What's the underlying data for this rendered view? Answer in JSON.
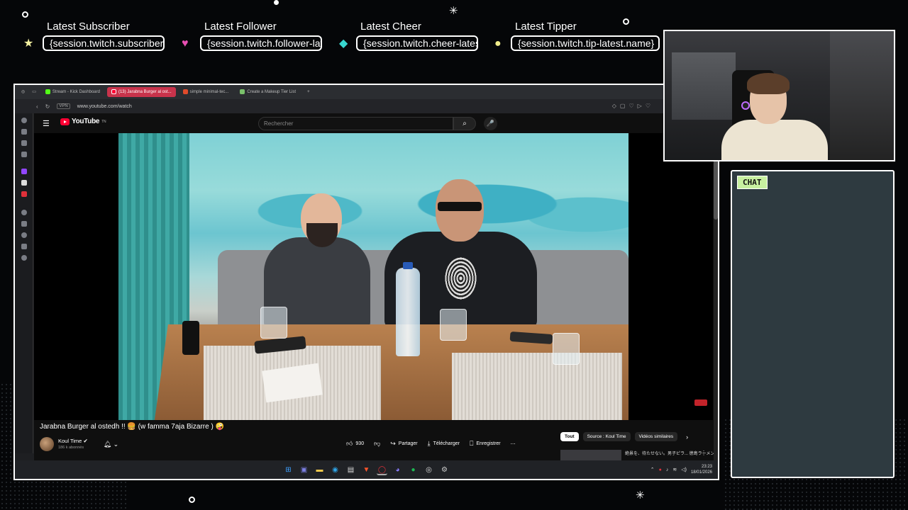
{
  "overlay": {
    "alerts": [
      {
        "label": "Latest Subscriber",
        "value": "{session.twitch.subscriber-latest.name}"
      },
      {
        "label": "Latest Follower",
        "value": "{session.twitch.follower-latest.name}"
      },
      {
        "label": "Latest Cheer",
        "value": "{session.twitch.cheer-latest.name}"
      },
      {
        "label": "Latest Tipper",
        "value": "{session.twitch.tip-latest.name}"
      }
    ],
    "chat_label": "CHAT"
  },
  "browser": {
    "tabs": [
      {
        "label": "Stream - Kick Dashboard",
        "color": "#53fc18"
      },
      {
        "label": "(13) Jarabna Burger al ost...",
        "color": "#ff0033",
        "active": true
      },
      {
        "label": "simple minimal-tec...",
        "color": "#e04b2b"
      },
      {
        "label": "Create a Makeup Tier List",
        "color": "#7ac16b"
      }
    ],
    "new_tab": "+",
    "url": "www.youtube.com/watch",
    "vpn": "VPN"
  },
  "youtube": {
    "logo": "YouTube",
    "logo_region": "TN",
    "search_placeholder": "Rechercher",
    "video_title": "Jarabna Burger al ostedh !! 🍔 (w famma 7aja Bizarre ) 🤪",
    "channel_name": "Koul Time",
    "subscribers": "186 k abonnés",
    "actions": {
      "likes": "930",
      "share": "Partager",
      "download": "Télécharger",
      "save": "Enregistrer",
      "more": "⋯"
    },
    "chips": [
      {
        "label": "Tout",
        "selected": true
      },
      {
        "label": "Source : Koul Time"
      },
      {
        "label": "Vidéos similaires"
      }
    ],
    "recommended_title": "絶景を、待たせない。男子ピラ... 徳島ラーメン(朝)ノ ル ト"
  },
  "taskbar": {
    "time": "23:23",
    "date": "18/01/2026"
  }
}
